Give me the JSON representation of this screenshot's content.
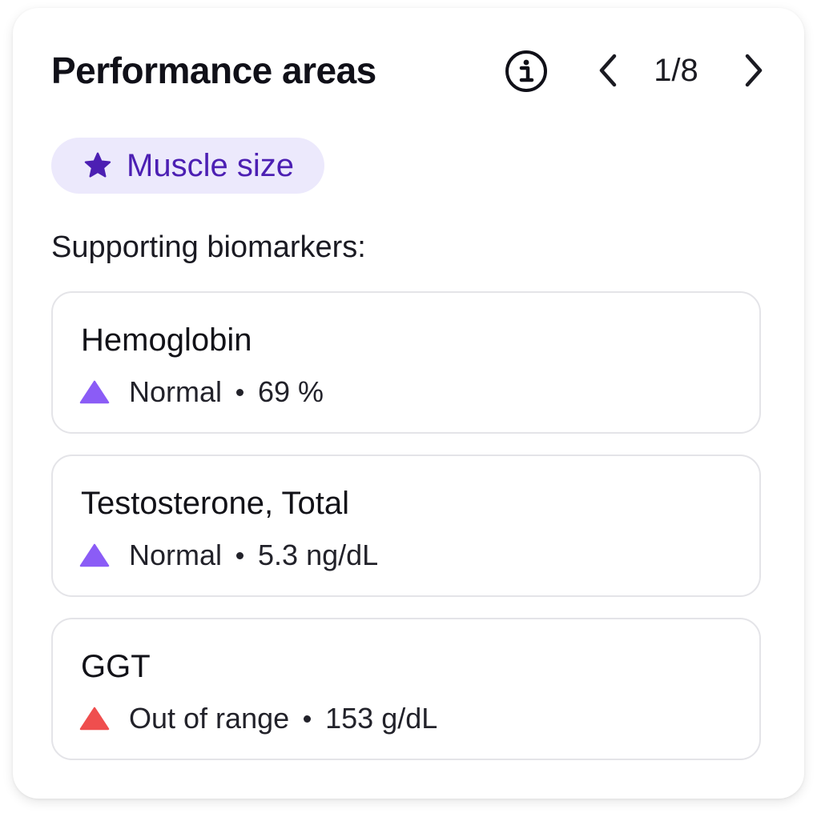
{
  "card": {
    "title": "Performance areas",
    "pager": "1/8",
    "tag": {
      "label": "Muscle size",
      "icon": "star-icon"
    },
    "section_label": "Supporting biomarkers:",
    "biomarkers": [
      {
        "name": "Hemoglobin",
        "status": "Normal",
        "value": "69 %",
        "status_color": "#8b5cf6"
      },
      {
        "name": "Testosterone, Total",
        "status": "Normal",
        "value": "5.3 ng/dL",
        "status_color": "#8b5cf6"
      },
      {
        "name": "GGT",
        "status": "Out of range",
        "value": "153 g/dL",
        "status_color": "#ef4e4e"
      }
    ]
  },
  "colors": {
    "tag_bg": "#ece9fc",
    "tag_text": "#4c1fb3",
    "normal": "#8b5cf6",
    "out_of_range": "#ef4e4e"
  }
}
